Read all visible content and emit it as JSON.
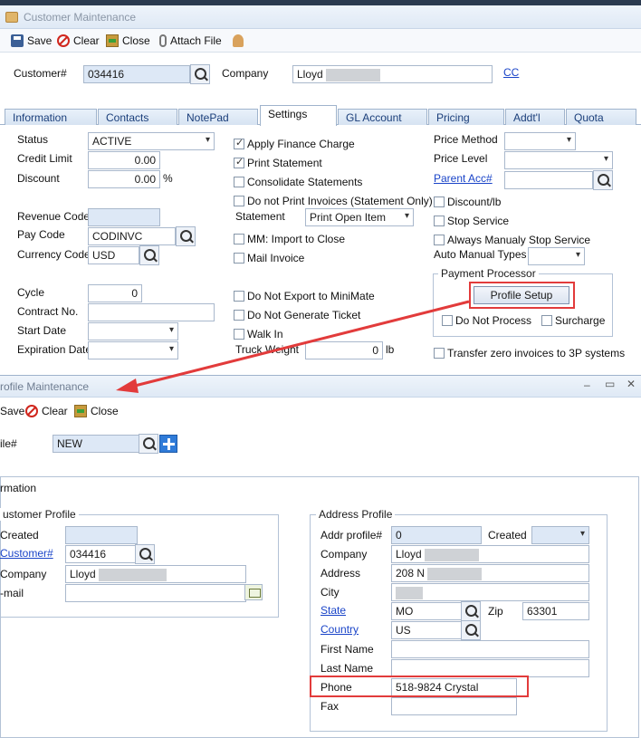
{
  "window1": {
    "title": "Customer Maintenance",
    "toolbar": {
      "save": "Save",
      "clear": "Clear",
      "close": "Close",
      "attach": "Attach File"
    },
    "header": {
      "customer_label": "Customer#",
      "customer_value": "034416",
      "company_label": "Company",
      "company_value": "Lloyd",
      "cc_link": "CC"
    },
    "tabs": [
      "Information",
      "Contacts",
      "NotePad",
      "Settings",
      "GL Account",
      "Pricing",
      "Addt'l",
      "Quota"
    ],
    "active_tab": "Settings",
    "left": {
      "status_label": "Status",
      "status_value": "ACTIVE",
      "credit_label": "Credit Limit",
      "credit_value": "0.00",
      "discount_label": "Discount",
      "discount_value": "0.00",
      "discount_unit": "%",
      "revenue_label": "Revenue Code",
      "revenue_value": "",
      "paycode_label": "Pay Code",
      "paycode_value": "CODINVC",
      "currency_label": "Currency Code",
      "currency_value": "USD",
      "cycle_label": "Cycle",
      "cycle_value": "0",
      "contract_label": "Contract No.",
      "contract_value": "",
      "start_label": "Start Date",
      "start_value": "",
      "expiration_label": "Expiration Date",
      "expiration_value": ""
    },
    "middle": {
      "apply_finance": "Apply Finance Charge",
      "print_statement": "Print Statement",
      "consolidate": "Consolidate Statements",
      "no_print_invoices": "Do not Print Invoices (Statement Only)",
      "statement_label": "Statement",
      "statement_value": "Print Open Item",
      "mm_import": "MM:  Import to Close",
      "mail_invoice": "Mail Invoice",
      "no_export": "Do Not Export to MiniMate",
      "no_ticket": "Do Not Generate Ticket",
      "walk_in": "Walk In",
      "truck_weight_label": "Truck Weight",
      "truck_weight_value": "0",
      "truck_weight_unit": "lb"
    },
    "right": {
      "price_method_label": "Price Method",
      "price_method_value": "",
      "price_level_label": "Price Level",
      "price_level_value": "",
      "parent_acc_link": "Parent Acc#",
      "parent_acc_value": "",
      "discount_lb": "Discount/lb",
      "stop_service": "Stop Service",
      "always_manual_stop": "Always Manualy Stop Service",
      "auto_manual_label": "Auto Manual Types",
      "auto_manual_value": "",
      "payment_processor_title": "Payment Processor",
      "profile_setup": "Profile Setup",
      "do_not_process": "Do Not Process",
      "surcharge": "Surcharge",
      "transfer_zero": "Transfer zero invoices to 3P systems"
    }
  },
  "window2": {
    "title": "rofile Maintenance",
    "toolbar": {
      "save": "Save",
      "clear": "Clear",
      "close": "Close"
    },
    "profile_label": "ile#",
    "profile_value": "NEW",
    "section_label": "rmation",
    "customer_profile": {
      "title": "ustomer Profile",
      "created_label": "Created",
      "created_value": "",
      "customer_link": "Customer#",
      "customer_value": "034416",
      "company_label": "Company",
      "company_value": "Lloyd",
      "email_label": "-mail",
      "email_value": ""
    },
    "address_profile": {
      "title": "Address Profile",
      "addr_label": "Addr profile#",
      "addr_value": "0",
      "created_label": "Created",
      "created_value": "",
      "company_label": "Company",
      "company_value": "Lloyd",
      "address_label": "Address",
      "address_value": "208 N",
      "city_label": "City",
      "city_value": "",
      "state_link": "State",
      "state_value": "MO",
      "zip_label": "Zip",
      "zip_value": "63301",
      "country_link": "Country",
      "country_value": "US",
      "first_label": "First Name",
      "first_value": "",
      "last_label": "Last Name",
      "last_value": "",
      "phone_label": "Phone",
      "phone_value": "518-9824 Crystal",
      "fax_label": "Fax",
      "fax_value": ""
    }
  },
  "colors": {
    "highlight": "#e23b3b",
    "link": "#1a44c8",
    "tab_bg": "#d6e3f2"
  }
}
